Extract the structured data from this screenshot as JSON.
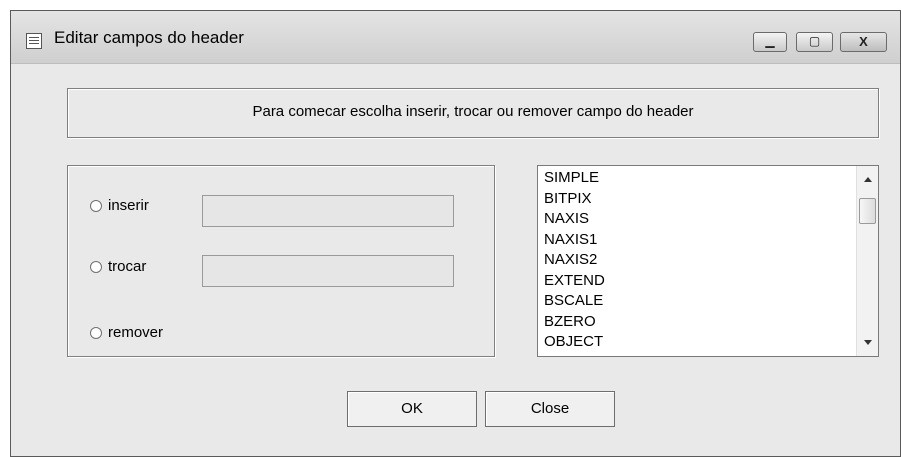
{
  "window": {
    "title": "Editar campos do header",
    "controls": {
      "minimize": "▁",
      "maximize": "▢",
      "close": "X"
    }
  },
  "message": "Para comecar escolha inserir, trocar ou remover campo do header",
  "options": [
    {
      "label": "inserir",
      "has_field": true,
      "field_value": ""
    },
    {
      "label": "trocar",
      "has_field": true,
      "field_value": ""
    },
    {
      "label": "remover",
      "has_field": false
    }
  ],
  "header_keywords": [
    "SIMPLE",
    "BITPIX",
    "NAXIS",
    "NAXIS1",
    "NAXIS2",
    "EXTEND",
    "BSCALE",
    "BZERO",
    "OBJECT"
  ],
  "buttons": {
    "ok": "OK",
    "close": "Close"
  }
}
